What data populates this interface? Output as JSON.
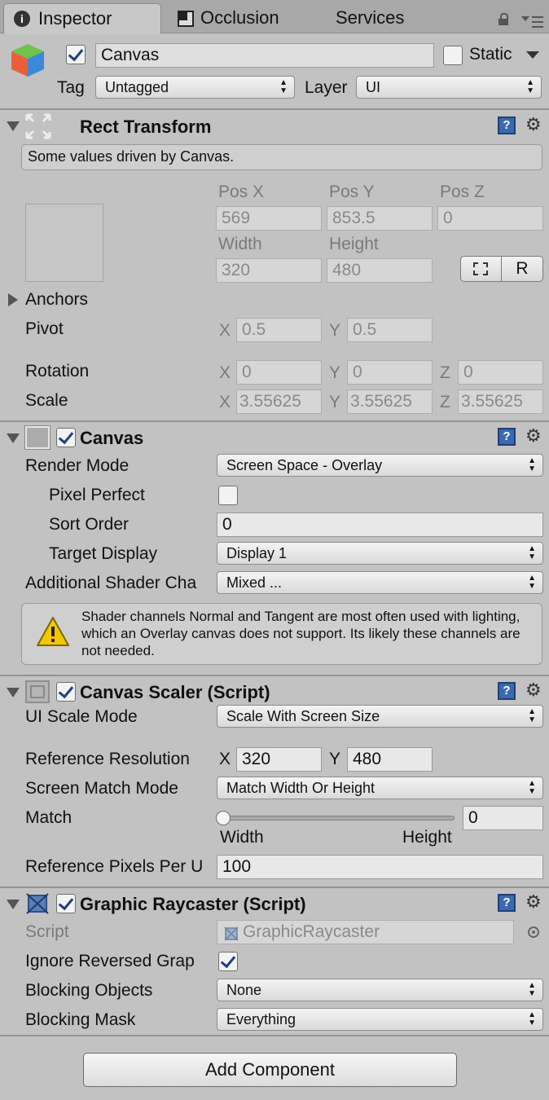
{
  "tabs": [
    {
      "label": "Inspector",
      "icon": "info-icon",
      "active": true
    },
    {
      "label": "Occlusion",
      "icon": "occlusion-icon",
      "active": false
    },
    {
      "label": "Services",
      "active": false
    }
  ],
  "object": {
    "name": "Canvas",
    "active": true,
    "static_label": "Static",
    "static": false,
    "tag_label": "Tag",
    "tag_value": "Untagged",
    "layer_label": "Layer",
    "layer_value": "UI"
  },
  "rect_transform": {
    "title": "Rect Transform",
    "note": "Some values driven by Canvas.",
    "pos_x_label": "Pos X",
    "pos_x": "569",
    "pos_y_label": "Pos Y",
    "pos_y": "853.5",
    "pos_z_label": "Pos Z",
    "pos_z": "0",
    "width_label": "Width",
    "width": "320",
    "height_label": "Height",
    "height": "480",
    "raw_button": "R",
    "anchors_label": "Anchors",
    "pivot_label": "Pivot",
    "pivot_x": "0.5",
    "pivot_y": "0.5",
    "rotation_label": "Rotation",
    "rot_x": "0",
    "rot_y": "0",
    "rot_z": "0",
    "scale_label": "Scale",
    "scale_x": "3.55625",
    "scale_y": "3.55625",
    "scale_z": "3.55625"
  },
  "axis": {
    "x": "X",
    "y": "Y",
    "z": "Z"
  },
  "canvas": {
    "title": "Canvas",
    "enabled": true,
    "render_mode_label": "Render Mode",
    "render_mode": "Screen Space - Overlay",
    "pixel_perfect_label": "Pixel Perfect",
    "pixel_perfect": false,
    "sort_order_label": "Sort Order",
    "sort_order": "0",
    "target_display_label": "Target Display",
    "target_display": "Display 1",
    "shader_label": "Additional Shader Cha",
    "shader_value": "Mixed ...",
    "warning": "Shader channels Normal and Tangent are most often used with lighting, which an Overlay canvas does not support. Its likely these channels are not needed."
  },
  "canvas_scaler": {
    "title": "Canvas Scaler (Script)",
    "enabled": true,
    "ui_scale_mode_label": "UI Scale Mode",
    "ui_scale_mode": "Scale With Screen Size",
    "ref_res_label": "Reference Resolution",
    "ref_x": "320",
    "ref_y": "480",
    "match_mode_label": "Screen Match Mode",
    "match_mode": "Match Width Or Height",
    "match_label": "Match",
    "match_value": "0",
    "slider_level": 0,
    "width_label": "Width",
    "height_label": "Height",
    "ref_ppu_label": "Reference Pixels Per U",
    "ref_ppu": "100"
  },
  "graphic_raycaster": {
    "title": "Graphic Raycaster (Script)",
    "enabled": true,
    "script_label": "Script",
    "script_value": "GraphicRaycaster",
    "ignore_reversed_label": "Ignore Reversed Grap",
    "ignore_reversed": true,
    "blocking_objects_label": "Blocking Objects",
    "blocking_objects": "None",
    "blocking_mask_label": "Blocking Mask",
    "blocking_mask": "Everything"
  },
  "add_component_label": "Add Component"
}
